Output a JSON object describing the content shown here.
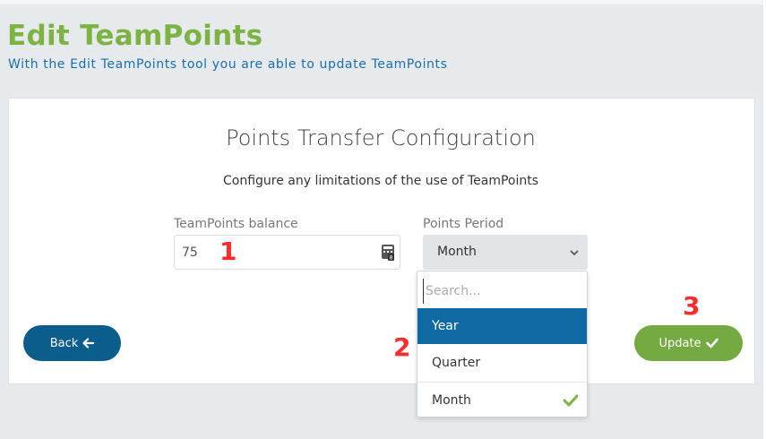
{
  "header": {
    "title": "Edit TeamPoints",
    "subtitle": "With the Edit TeamPoints tool you are able to update TeamPoints"
  },
  "card": {
    "title": "Points Transfer Configuration",
    "description": "Configure any limitations of the use of TeamPoints"
  },
  "balance": {
    "label": "TeamPoints balance",
    "value": "75",
    "icon": "calculator-icon"
  },
  "period": {
    "label": "Points Period",
    "selected": "Month",
    "search_placeholder": "Search...",
    "options": [
      {
        "label": "Year",
        "highlighted": true
      },
      {
        "label": "Quarter",
        "highlighted": false
      },
      {
        "label": "Month",
        "checked": true
      }
    ]
  },
  "buttons": {
    "back_label": "Back",
    "update_label": "Update"
  },
  "annotations": [
    "1",
    "2",
    "3"
  ],
  "colors": {
    "title_green": "#7cb342",
    "subtitle_blue": "#1a6fa8",
    "back_blue": "#0b5d8c",
    "highlight_blue": "#0f6aa3",
    "update_green": "#75a941",
    "marker_red": "#ff2a2a"
  }
}
